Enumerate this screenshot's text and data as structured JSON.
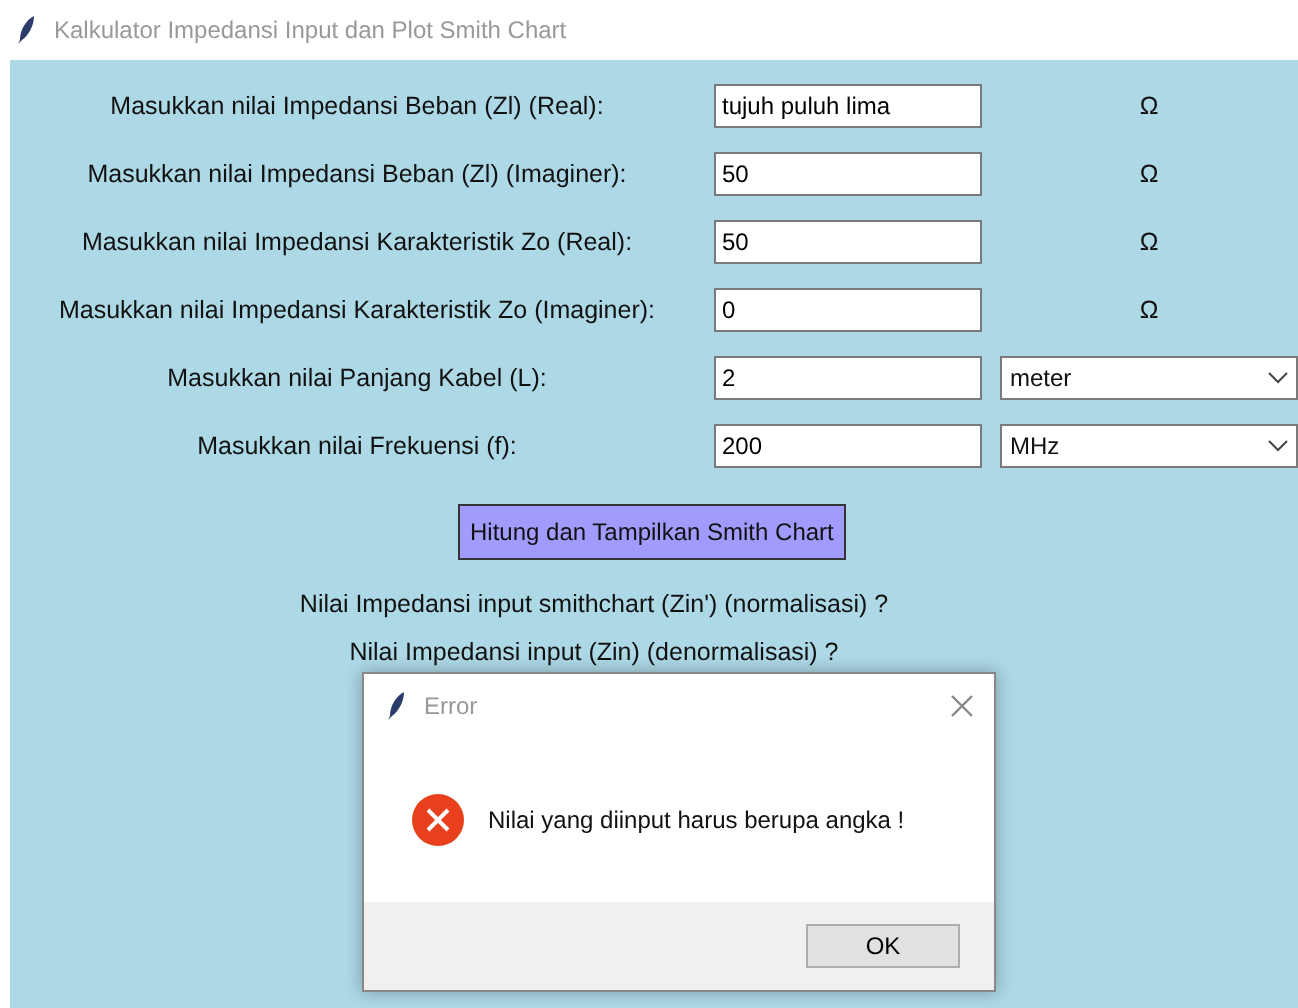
{
  "window": {
    "title": "Kalkulator Impedansi Input dan Plot Smith Chart"
  },
  "rows": [
    {
      "label": "Masukkan nilai Impedansi Beban (Zl) (Real):",
      "value": "tujuh puluh lima",
      "kind": "text",
      "unit": "Ω"
    },
    {
      "label": "Masukkan nilai Impedansi Beban (Zl) (Imaginer):",
      "value": "50",
      "kind": "text",
      "unit": "Ω"
    },
    {
      "label": "Masukkan nilai Impedansi Karakteristik Zo (Real):",
      "value": "50",
      "kind": "text",
      "unit": "Ω"
    },
    {
      "label": "Masukkan nilai Impedansi Karakteristik Zo (Imaginer):",
      "value": "0",
      "kind": "text",
      "unit": "Ω"
    },
    {
      "label": "Masukkan nilai Panjang Kabel (L):",
      "value": "2",
      "kind": "select",
      "unit": "meter"
    },
    {
      "label": "Masukkan nilai Frekuensi (f):",
      "value": "200",
      "kind": "select",
      "unit": "MHz"
    }
  ],
  "action_button": "Hitung dan Tampilkan Smith Chart",
  "results": [
    "Nilai Impedansi input smithchart (Zin') (normalisasi) ?",
    "Nilai Impedansi input (Zin) (denormalisasi) ?"
  ],
  "dialog": {
    "title": "Error",
    "message": "Nilai yang diinput harus berupa angka !",
    "button": "OK"
  }
}
